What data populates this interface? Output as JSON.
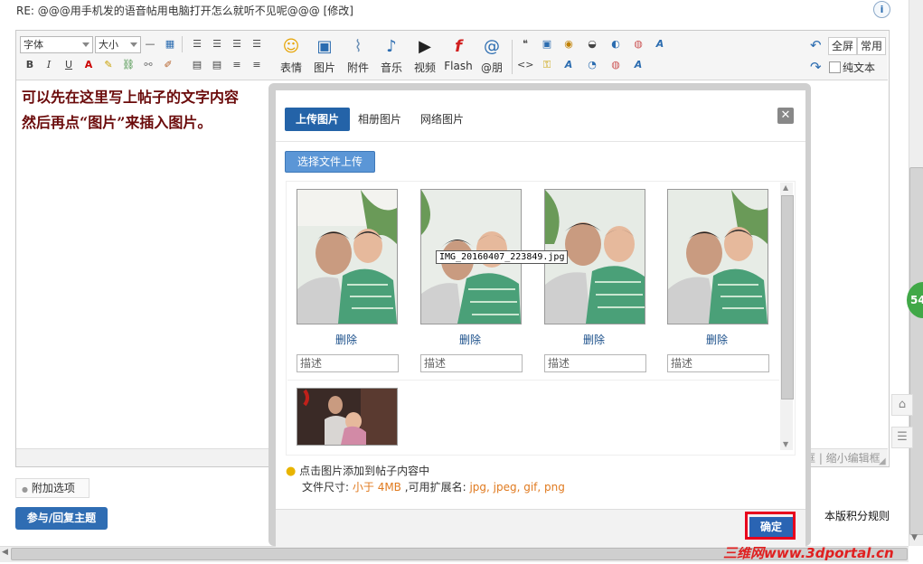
{
  "header": {
    "title": "RE: @@@用手机发的语音帖用电脑打开怎么就听不见呢@@@",
    "edit_link": "[修改]",
    "info_icon": "i"
  },
  "toolbar": {
    "font_select": "字体",
    "size_select": "大小",
    "big_buttons": [
      {
        "label": "表情",
        "icon": "smiley-icon",
        "glyph": "☺"
      },
      {
        "label": "图片",
        "icon": "image-icon",
        "glyph": "▣"
      },
      {
        "label": "附件",
        "icon": "paperclip-icon",
        "glyph": "⌇"
      },
      {
        "label": "音乐",
        "icon": "music-icon",
        "glyph": "♪"
      },
      {
        "label": "视频",
        "icon": "video-icon",
        "glyph": "▶"
      },
      {
        "label": "Flash",
        "icon": "flash-icon",
        "glyph": "f"
      },
      {
        "label": "@朋",
        "icon": "at-icon",
        "glyph": "@"
      }
    ],
    "fullscreen": "全屏",
    "common": "常用",
    "plain_text": "纯文本"
  },
  "editor": {
    "line1": "可以先在这里写上帖子的文字内容",
    "line2": "然后再点“图片”来插入图片。",
    "zoom_links": "框 | 缩小编辑框"
  },
  "extra_options": "附加选项",
  "reply_button": "参与/回复主题",
  "rules_link": "本版积分规则",
  "badge": "54",
  "watermark": "三维网www.3dportal.cn",
  "dialog": {
    "tabs": [
      "上传图片",
      "相册图片",
      "网络图片"
    ],
    "choose_button": "选择文件上传",
    "delete_label": "删除",
    "desc_placeholder": "描述",
    "tooltip": "IMG_20160407_223849.jpg",
    "hint": "点击图片添加到帖子内容中",
    "size_label": "文件尺寸:",
    "size_value": "小于 4MB",
    "ext_label": ",可用扩展名:",
    "ext_value": "jpg, jpeg, gif, png",
    "ok_button": "确定"
  },
  "colors": {
    "accent": "#2463a8",
    "editor_text": "#6b0b0b",
    "highlight": "#e8001c",
    "badge": "#41a848"
  }
}
